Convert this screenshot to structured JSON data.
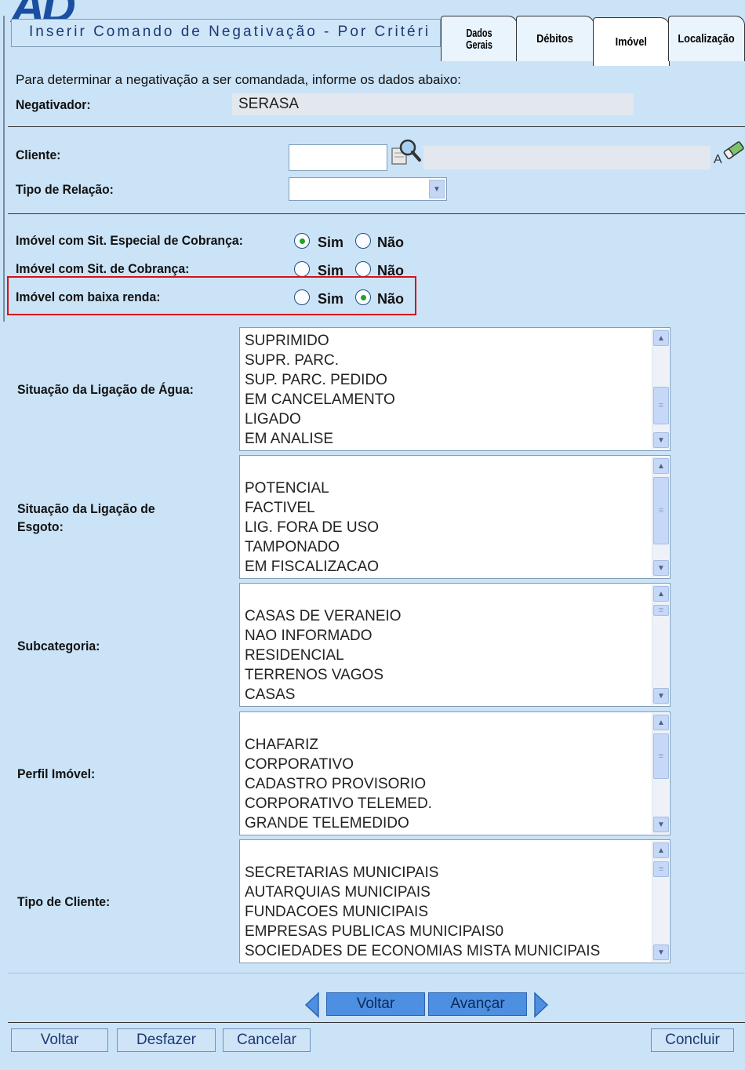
{
  "logo": {
    "text": "AD"
  },
  "window": {
    "title": "Inserir Comando de Negativação - Por Critéri"
  },
  "tabs": [
    {
      "label": "Dados Gerais",
      "active": false
    },
    {
      "label": "Débitos",
      "active": false
    },
    {
      "label": "Imóvel",
      "active": true
    },
    {
      "label": "Localização",
      "active": false
    }
  ],
  "form": {
    "intro": "Para determinar a negativação a ser comandada, informe os dados abaixo:",
    "negativador_label": "Negativador:",
    "negativador_value": "SERASA",
    "cliente_label": "Cliente:",
    "cliente_value": "",
    "cliente_name": "",
    "tipo_relacao_label": "Tipo de Relação:",
    "tipo_relacao_value": "",
    "radios": [
      {
        "label": "Imóvel com Sit. Especial de Cobrança:",
        "yes": "Sim",
        "no": "Não",
        "selected": "Sim"
      },
      {
        "label": "Imóvel com Sit. de Cobrança:",
        "yes": "Sim",
        "no": "Não",
        "selected": ""
      },
      {
        "label": "Imóvel com baixa renda:",
        "yes": "Sim",
        "no": "Não",
        "selected": "Não"
      }
    ],
    "lists": [
      {
        "label": "Situação da Ligação de Água:",
        "items": [
          "SUPRIMIDO",
          "SUPR. PARC.",
          "SUP. PARC. PEDIDO",
          "EM CANCELAMENTO",
          "LIGADO",
          "EM ANALISE"
        ]
      },
      {
        "label": "Situação da Ligação de Esgoto:",
        "label_line1": "Situação da Ligação de",
        "label_line2": "Esgoto:",
        "items": [
          "POTENCIAL",
          "FACTIVEL",
          "LIG. FORA DE USO",
          "TAMPONADO",
          "EM FISCALIZACAO"
        ]
      },
      {
        "label": "Subcategoria:",
        "items": [
          "CASAS DE VERANEIO",
          "NAO INFORMADO",
          "RESIDENCIAL",
          "TERRENOS VAGOS",
          "CASAS"
        ]
      },
      {
        "label": "Perfil Imóvel:",
        "items": [
          "CHAFARIZ",
          "CORPORATIVO",
          "CADASTRO PROVISORIO",
          "CORPORATIVO TELEMED.",
          "GRANDE TELEMEDIDO"
        ]
      },
      {
        "label": "Tipo de Cliente:",
        "items": [
          "SECRETARIAS MUNICIPAIS",
          "AUTARQUIAS MUNICIPAIS",
          "FUNDACOES MUNICIPAIS",
          "EMPRESAS PUBLICAS MUNICIPAIS0",
          "SOCIEDADES DE ECONOMIAS MISTA MUNICIPAIS"
        ]
      }
    ]
  },
  "nav": {
    "back": "Voltar",
    "next": "Avançar"
  },
  "footer": {
    "voltar": "Voltar",
    "desfazer": "Desfazer",
    "cancelar": "Cancelar",
    "concluir": "Concluir"
  },
  "colors": {
    "background": "#cbe3f7",
    "highlight": "#d5121b",
    "button_primary": "#4d8fe0"
  }
}
